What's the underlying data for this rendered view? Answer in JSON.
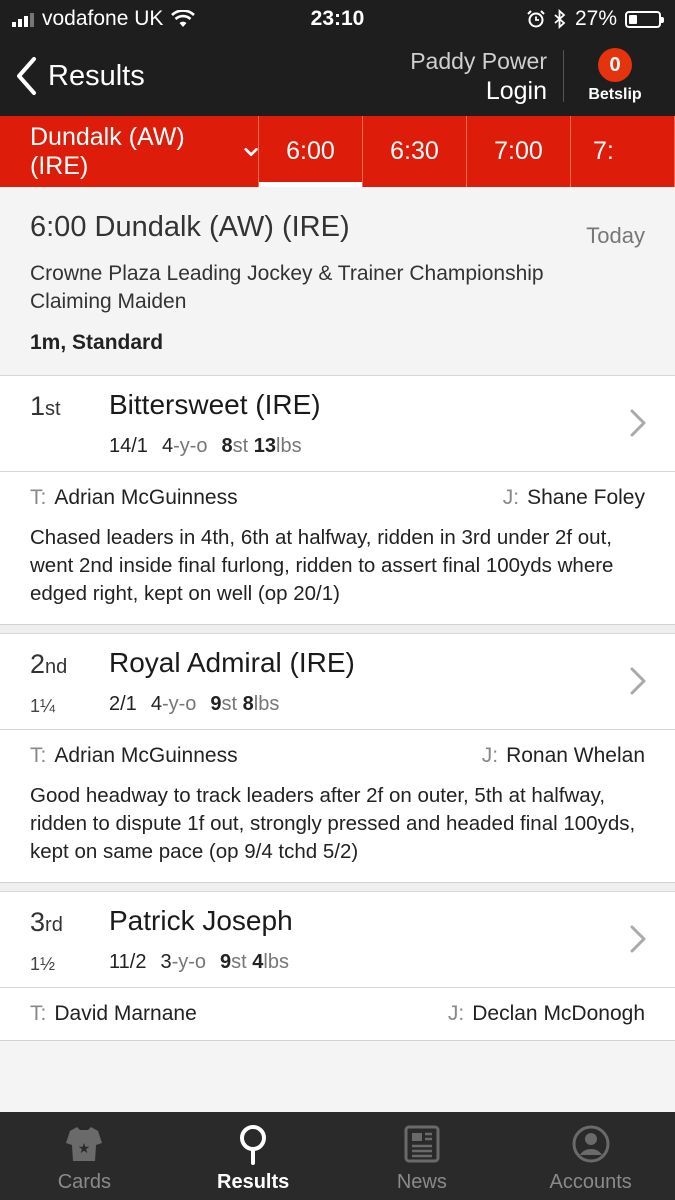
{
  "status": {
    "carrier": "vodafone UK",
    "time": "23:10",
    "battery": "27%",
    "battery_level": 0.27
  },
  "nav": {
    "back_label": "Results",
    "brand": "Paddy Power",
    "login": "Login",
    "betslip_count": "0",
    "betslip_label": "Betslip"
  },
  "race_bar": {
    "venue": "Dundalk (AW) (IRE)",
    "times": [
      "6:00",
      "6:30",
      "7:00",
      "7:"
    ]
  },
  "race": {
    "title": "6:00 Dundalk (AW) (IRE)",
    "day": "Today",
    "name": "Crowne Plaza Leading Jockey & Trainer Championship Claiming Maiden",
    "conditions": "1m, Standard"
  },
  "runners": [
    {
      "pos": "1",
      "suffix": "st",
      "distance": "",
      "horse": "Bittersweet (IRE)",
      "odds": "14/1",
      "age": "4",
      "age_unit": "-y-o",
      "st": "8",
      "st_unit": "st",
      "lbs": "13",
      "lbs_unit": "lbs",
      "trainer_label": "T:",
      "trainer": "Adrian McGuinness",
      "jockey_label": "J:",
      "jockey": "Shane Foley",
      "comment": "Chased leaders in 4th, 6th at halfway, ridden in 3rd under 2f out, went 2nd inside final furlong, ridden to assert final 100yds where edged right, kept on well (op 20/1)"
    },
    {
      "pos": "2",
      "suffix": "nd",
      "distance": "1¼",
      "horse": "Royal Admiral (IRE)",
      "odds": "2/1",
      "age": "4",
      "age_unit": "-y-o",
      "st": "9",
      "st_unit": "st",
      "lbs": "8",
      "lbs_unit": "lbs",
      "trainer_label": "T:",
      "trainer": "Adrian McGuinness",
      "jockey_label": "J:",
      "jockey": "Ronan Whelan",
      "comment": "Good headway to track leaders after 2f on outer, 5th at halfway, ridden to dispute 1f out, strongly pressed and headed final 100yds, kept on same pace (op 9/4 tchd 5/2)"
    },
    {
      "pos": "3",
      "suffix": "rd",
      "distance": "1½",
      "horse": "Patrick Joseph",
      "odds": "11/2",
      "age": "3",
      "age_unit": "-y-o",
      "st": "9",
      "st_unit": "st",
      "lbs": "4",
      "lbs_unit": "lbs",
      "trainer_label": "T:",
      "trainer": "David Marnane",
      "jockey_label": "J:",
      "jockey": "Declan McDonogh",
      "comment": ""
    }
  ],
  "tabs": [
    {
      "label": "Cards",
      "icon": "jersey-icon"
    },
    {
      "label": "Results",
      "icon": "magnifier-icon"
    },
    {
      "label": "News",
      "icon": "newspaper-icon"
    },
    {
      "label": "Accounts",
      "icon": "person-icon"
    }
  ]
}
